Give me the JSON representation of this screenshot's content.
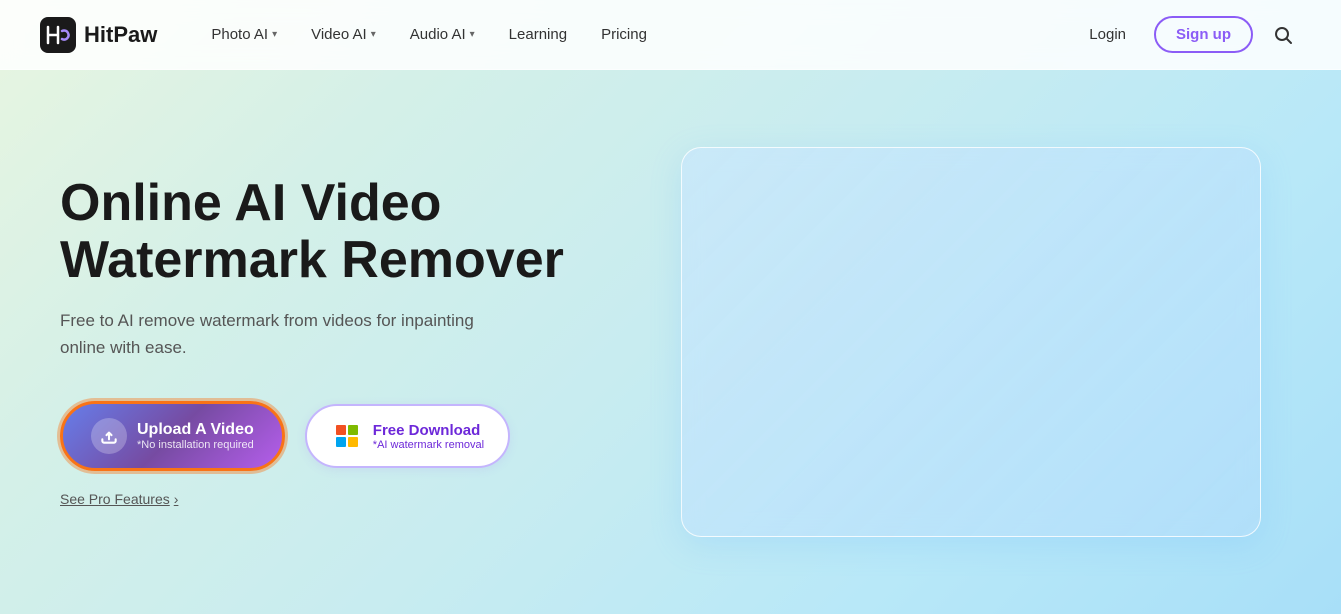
{
  "brand": {
    "logo_text": "HitPaw"
  },
  "navbar": {
    "items": [
      {
        "label": "Photo AI",
        "has_dropdown": true
      },
      {
        "label": "Video AI",
        "has_dropdown": true
      },
      {
        "label": "Audio AI",
        "has_dropdown": true
      },
      {
        "label": "Learning",
        "has_dropdown": false
      },
      {
        "label": "Pricing",
        "has_dropdown": false
      }
    ],
    "login_label": "Login",
    "signup_label": "Sign up"
  },
  "hero": {
    "title_line1": "Online AI Video",
    "title_line2": "Watermark Remover",
    "subtitle": "Free to AI remove watermark from videos for inpainting online with ease.",
    "upload_button": {
      "main": "Upload A Video",
      "sub": "*No installation required"
    },
    "freedownload_button": {
      "main": "Free Download",
      "sub": "*AI watermark removal"
    },
    "see_pro": "See Pro Features"
  }
}
